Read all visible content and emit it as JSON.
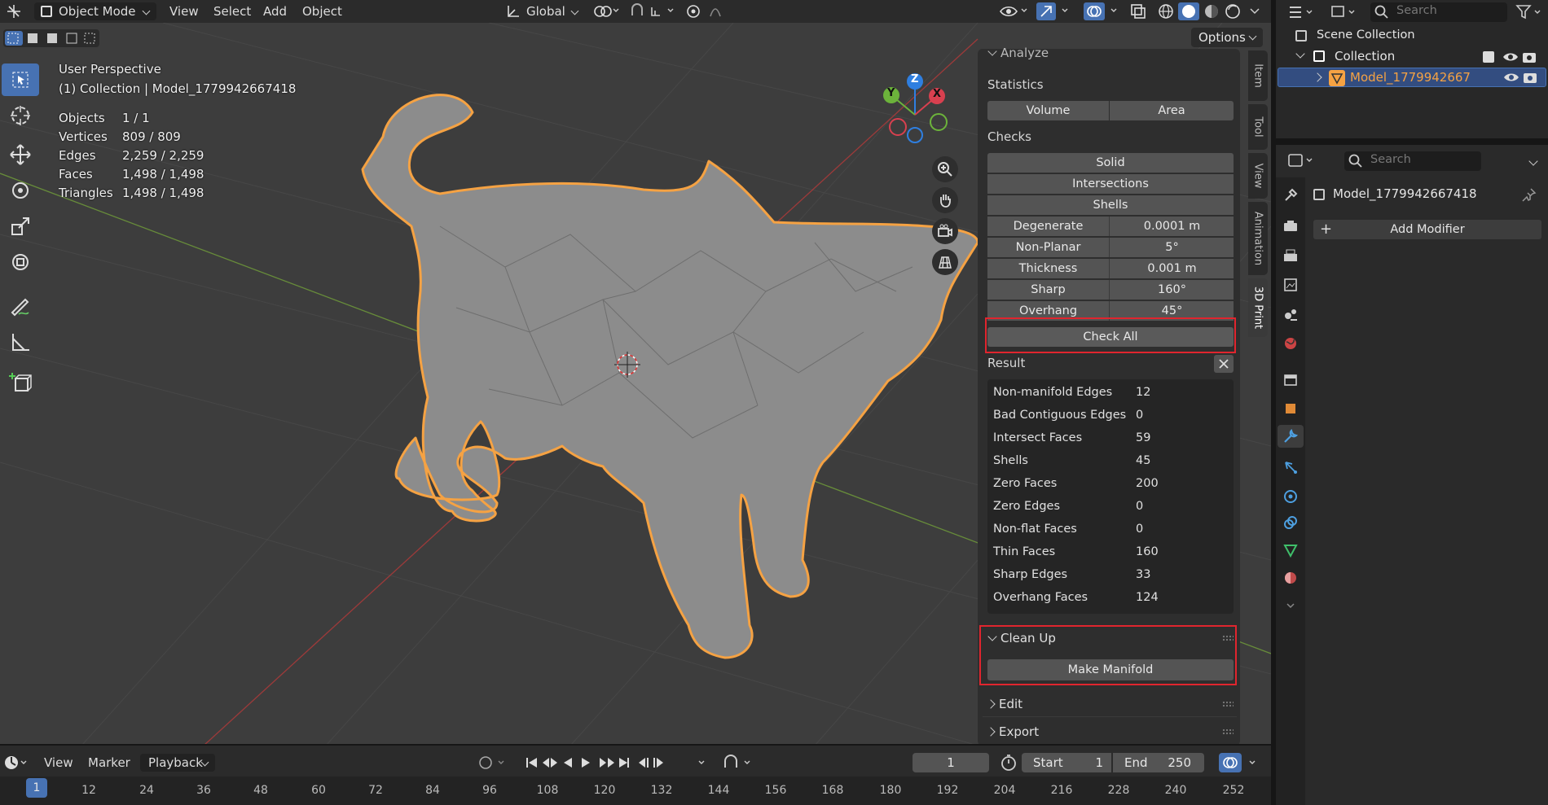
{
  "header": {
    "mode": "Object Mode",
    "menus": [
      "View",
      "Select",
      "Add",
      "Object"
    ],
    "orientation": "Global",
    "options_label": "Options"
  },
  "viewport": {
    "perspective": "User Perspective",
    "context": "(1) Collection | Model_1779942667418",
    "stats": [
      {
        "label": "Objects",
        "value": "1 / 1"
      },
      {
        "label": "Vertices",
        "value": "809 / 809"
      },
      {
        "label": "Edges",
        "value": "2,259 / 2,259"
      },
      {
        "label": "Faces",
        "value": "1,498 / 1,498"
      },
      {
        "label": "Triangles",
        "value": "1,498 / 1,498"
      }
    ],
    "gizmo": {
      "x": "X",
      "y": "Y",
      "z": "Z"
    }
  },
  "sidebar_tabs": [
    "Item",
    "Tool",
    "View",
    "Animation",
    "3D Print"
  ],
  "print_panel": {
    "analyze_label": "Analyze",
    "statistics_label": "Statistics",
    "volume_btn": "Volume",
    "area_btn": "Area",
    "checks_label": "Checks",
    "solid_btn": "Solid",
    "intersections_btn": "Intersections",
    "shells_btn": "Shells",
    "params": [
      {
        "label": "Degenerate",
        "value": "0.0001 m"
      },
      {
        "label": "Non-Planar",
        "value": "5°"
      },
      {
        "label": "Thickness",
        "value": "0.001 m"
      },
      {
        "label": "Sharp",
        "value": "160°"
      },
      {
        "label": "Overhang",
        "value": "45°"
      }
    ],
    "check_all_btn": "Check All",
    "result_label": "Result",
    "results": [
      {
        "label": "Non-manifold Edges",
        "value": "12"
      },
      {
        "label": "Bad Contiguous Edges",
        "value": "0"
      },
      {
        "label": "Intersect Faces",
        "value": "59"
      },
      {
        "label": "Shells",
        "value": "45"
      },
      {
        "label": "Zero Faces",
        "value": "200"
      },
      {
        "label": "Zero Edges",
        "value": "0"
      },
      {
        "label": "Non-flat Faces",
        "value": "0"
      },
      {
        "label": "Thin Faces",
        "value": "160"
      },
      {
        "label": "Sharp Edges",
        "value": "33"
      },
      {
        "label": "Overhang Faces",
        "value": "124"
      }
    ],
    "cleanup_label": "Clean Up",
    "make_manifold_btn": "Make Manifold",
    "edit_label": "Edit",
    "export_label": "Export"
  },
  "outliner": {
    "search_placeholder": "Search",
    "scene_collection": "Scene Collection",
    "collection": "Collection",
    "model": "Model_1779942667"
  },
  "properties": {
    "search_placeholder": "Search",
    "object_name": "Model_1779942667418",
    "add_modifier": "Add Modifier"
  },
  "timeline": {
    "menus": [
      "View",
      "Marker",
      "Playback"
    ],
    "current_frame": "1",
    "start_label": "Start",
    "start_value": "1",
    "end_label": "End",
    "end_value": "250",
    "ticks": [
      "1",
      "12",
      "24",
      "36",
      "48",
      "60",
      "72",
      "84",
      "96",
      "108",
      "120",
      "132",
      "144",
      "156",
      "168",
      "180",
      "192",
      "204",
      "216",
      "228",
      "240",
      "252"
    ]
  },
  "colors": {
    "accent": "#4772b3",
    "selection": "#f5a243",
    "highlight_box": "#e0252e"
  }
}
